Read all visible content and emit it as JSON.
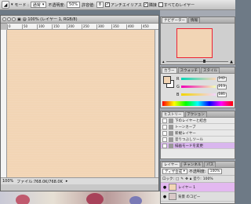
{
  "options_bar": {
    "mode_label": "モード :",
    "mode_value": "通常",
    "opacity_label": "不透明度:",
    "opacity_value": "50%",
    "tolerance_label": "許容値:",
    "tolerance_value": "8",
    "antialias_label": "アンチエイリアス",
    "contiguous_label": "隣接",
    "all_layers_label": "すべてのレイヤー",
    "palette_label": "パレット"
  },
  "document": {
    "title": "@ 100% (レイヤー 1, RGB/8)",
    "ruler_ticks": [
      "0",
      "50",
      "100",
      "150",
      "200",
      "250",
      "300",
      "350",
      "400",
      "450"
    ],
    "status_zoom": "100%",
    "status_file": "ファイル:768.0K/768.0K",
    "canvas_color": "#f2d5b5"
  },
  "navigator": {
    "tabs": [
      "ナビゲーター",
      "情報"
    ],
    "thumb_border_color": "#e23333"
  },
  "color": {
    "tabs": [
      "カラー",
      "スウォッチ",
      "スタイル"
    ],
    "rows": [
      {
        "label": "R",
        "value": "242"
      },
      {
        "label": "G",
        "value": "213"
      },
      {
        "label": "B",
        "value": "181"
      }
    ],
    "foreground": "#f2d5b5"
  },
  "history": {
    "tabs": [
      "ヒストリー",
      "アクション"
    ],
    "items": [
      {
        "label": "下のレイヤーと結合",
        "selected": false
      },
      {
        "label": "トーンカーブ",
        "selected": false
      },
      {
        "label": "新規レイヤー",
        "selected": false
      },
      {
        "label": "塗りつぶしツール",
        "selected": false
      },
      {
        "label": "描画モードを変更",
        "selected": true
      }
    ]
  },
  "layers": {
    "tabs": [
      "レイヤー",
      "チャンネル",
      "パス"
    ],
    "blend_mode": "ディザ合成",
    "opacity_label": "不透明度:",
    "opacity_value": "100%",
    "lock_label": "ロック:",
    "fill_label": "塗り:",
    "fill_value": "100%",
    "items": [
      {
        "label": "レイヤー 1",
        "selected": true,
        "thumb": "#f2d5b5"
      },
      {
        "label": "背景 のコピー",
        "selected": false,
        "thumb": "#d8c8c8"
      }
    ]
  }
}
